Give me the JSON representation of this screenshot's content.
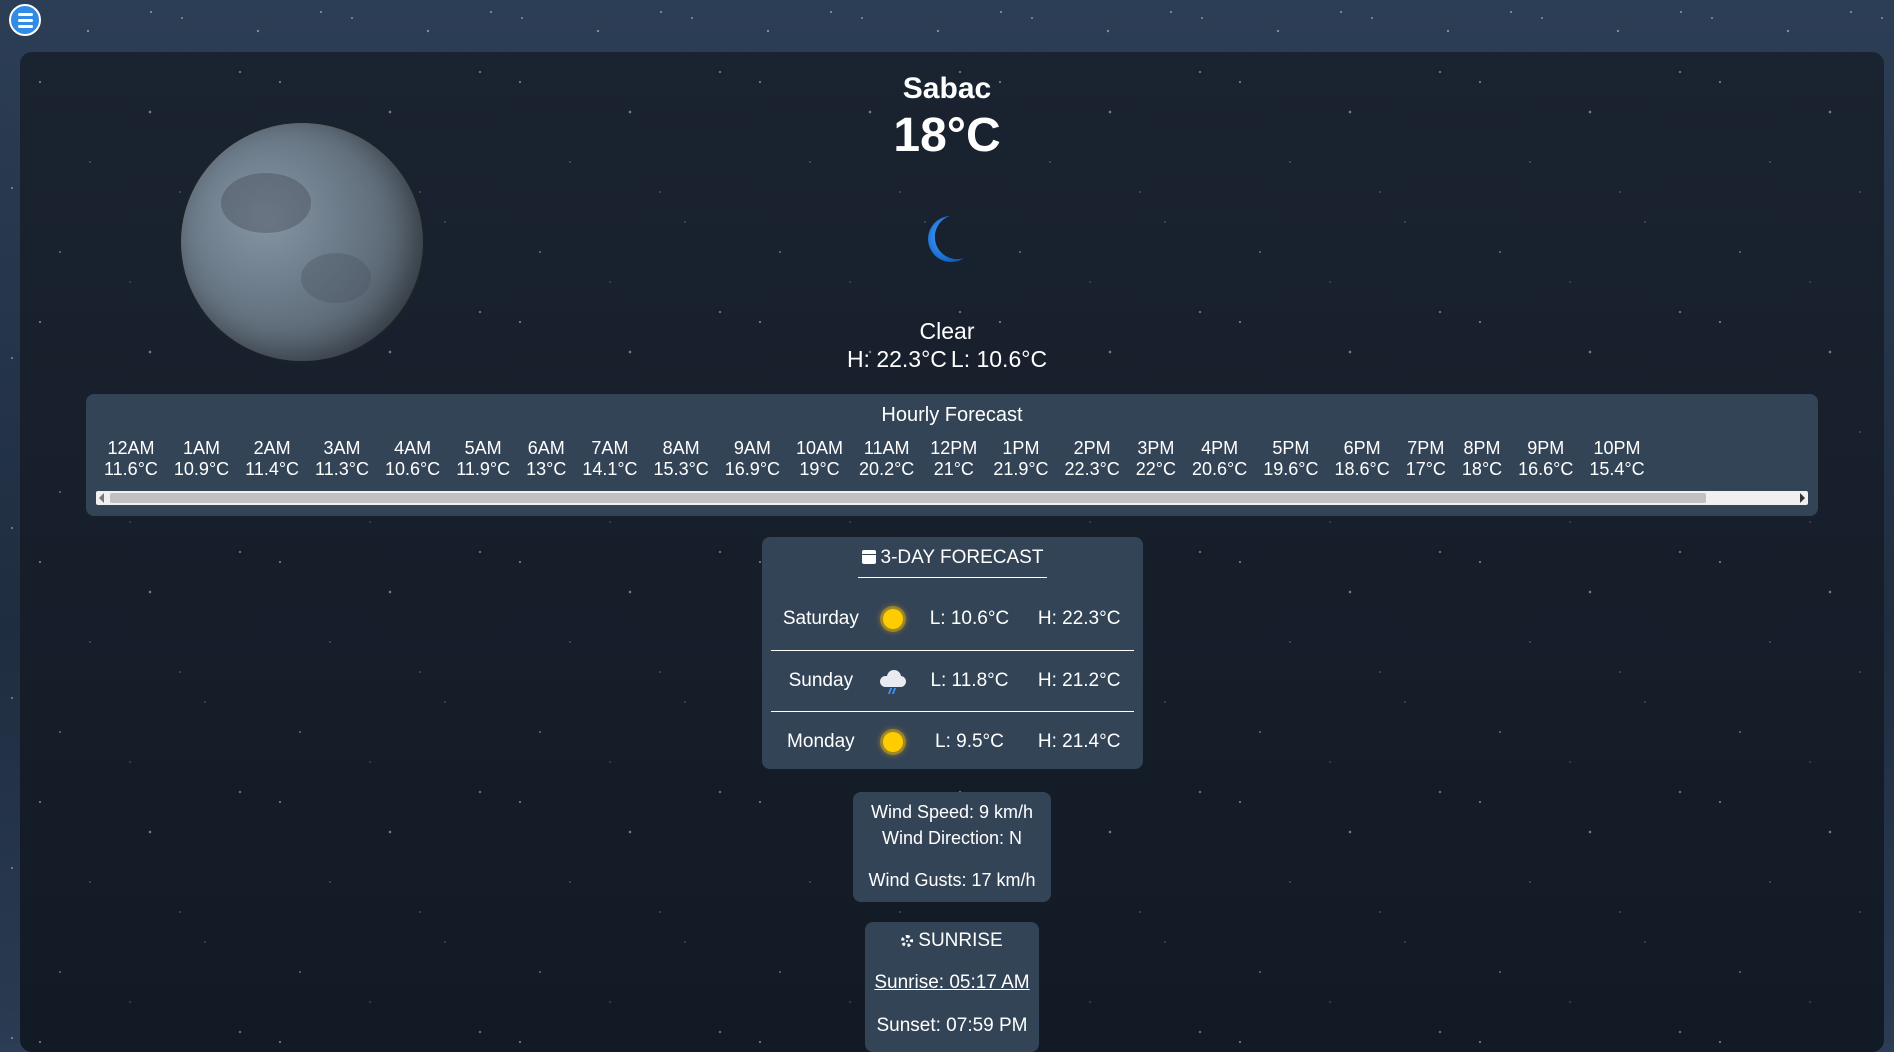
{
  "menu": {
    "icon": "hamburger-menu-icon"
  },
  "location": {
    "city": "Sabac"
  },
  "current": {
    "temperature": "18°C",
    "icon": "crescent-moon-icon",
    "condition": "Clear",
    "high": "H: 22.3°C",
    "low": "L: 10.6°C"
  },
  "hourly": {
    "title": "Hourly Forecast",
    "items": [
      {
        "time": "12AM",
        "temp": "11.6°C"
      },
      {
        "time": "1AM",
        "temp": "10.9°C"
      },
      {
        "time": "2AM",
        "temp": "11.4°C"
      },
      {
        "time": "3AM",
        "temp": "11.3°C"
      },
      {
        "time": "4AM",
        "temp": "10.6°C"
      },
      {
        "time": "5AM",
        "temp": "11.9°C"
      },
      {
        "time": "6AM",
        "temp": "13°C"
      },
      {
        "time": "7AM",
        "temp": "14.1°C"
      },
      {
        "time": "8AM",
        "temp": "15.3°C"
      },
      {
        "time": "9AM",
        "temp": "16.9°C"
      },
      {
        "time": "10AM",
        "temp": "19°C"
      },
      {
        "time": "11AM",
        "temp": "20.2°C"
      },
      {
        "time": "12PM",
        "temp": "21°C"
      },
      {
        "time": "1PM",
        "temp": "21.9°C"
      },
      {
        "time": "2PM",
        "temp": "22.3°C"
      },
      {
        "time": "3PM",
        "temp": "22°C"
      },
      {
        "time": "4PM",
        "temp": "20.6°C"
      },
      {
        "time": "5PM",
        "temp": "19.6°C"
      },
      {
        "time": "6PM",
        "temp": "18.6°C"
      },
      {
        "time": "7PM",
        "temp": "17°C"
      },
      {
        "time": "8PM",
        "temp": "18°C"
      },
      {
        "time": "9PM",
        "temp": "16.6°C"
      },
      {
        "time": "10PM",
        "temp": "15.4°C"
      }
    ]
  },
  "daily": {
    "title": "3-DAY FORECAST",
    "icon": "calendar-icon",
    "days": [
      {
        "day": "Saturday",
        "icon": "sun-icon",
        "low": "L: 10.6°C",
        "high": "H: 22.3°C"
      },
      {
        "day": "Sunday",
        "icon": "rain-cloud-icon",
        "low": "L: 11.8°C",
        "high": "H: 21.2°C"
      },
      {
        "day": "Monday",
        "icon": "sun-icon",
        "low": "L: 9.5°C",
        "high": "H: 21.4°C"
      }
    ]
  },
  "wind": {
    "speed": "Wind Speed: 9 km/h",
    "direction": "Wind Direction: N",
    "gusts": "Wind Gusts: 17 km/h"
  },
  "sun": {
    "title": "SUNRISE",
    "icon": "sun-gear-icon",
    "sunrise": "Sunrise: 05:17 AM",
    "sunset": "Sunset: 07:59 PM"
  },
  "colors": {
    "panel_bg": "#344457",
    "menu_button": "#2f8be6",
    "moon_icon": "#1e7fe0",
    "sun_icon": "#ffcc00"
  }
}
